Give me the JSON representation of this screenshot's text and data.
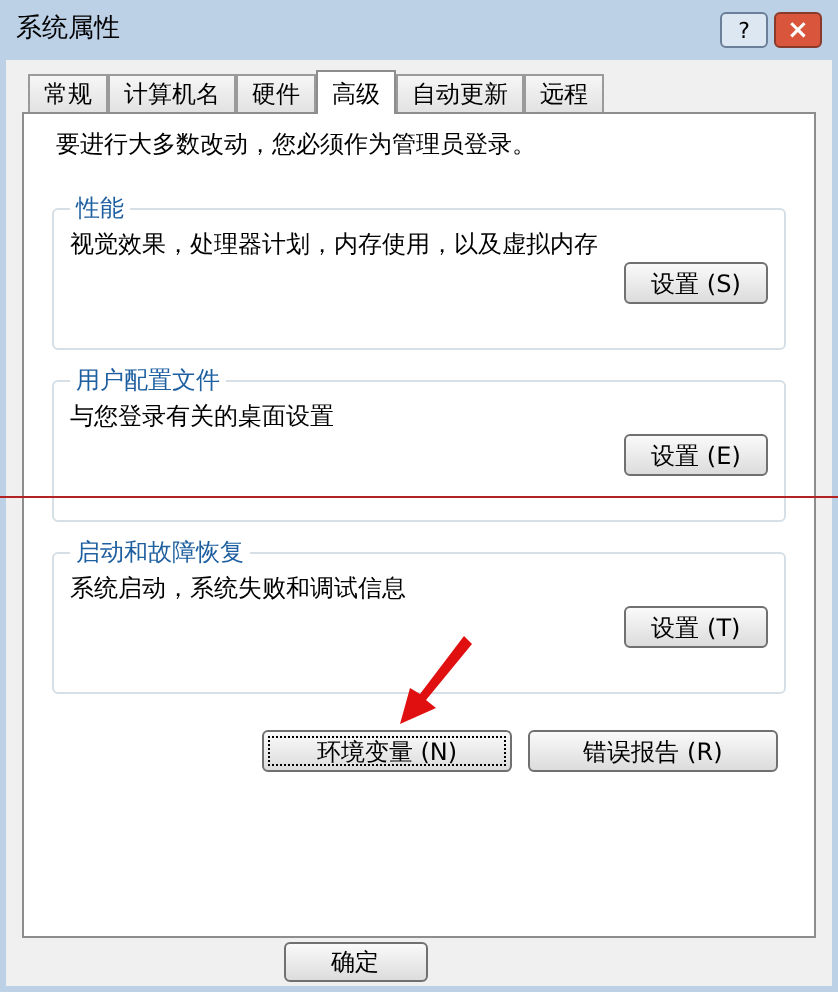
{
  "window": {
    "title": "系统属性",
    "controls": [
      "?",
      "×"
    ]
  },
  "tabs": [
    {
      "label": "常规",
      "selected": false
    },
    {
      "label": "计算机名",
      "selected": false
    },
    {
      "label": "硬件",
      "selected": false
    },
    {
      "label": "高级",
      "selected": true
    },
    {
      "label": "自动更新",
      "selected": false
    },
    {
      "label": "远程",
      "selected": false
    }
  ],
  "notice": "要进行大多数改动，您必须作为管理员登录。",
  "groups": [
    {
      "title": "性能",
      "description": "视觉效果，处理器计划，内存使用，以及虚拟内存",
      "button": "设置 (S)"
    },
    {
      "title": "用户配置文件",
      "description": "与您登录有关的桌面设置",
      "button": "设置 (E)"
    },
    {
      "title": "启动和故障恢复",
      "description": "系统启动，系统失败和调试信息",
      "button": "设置 (T)"
    }
  ],
  "buttons": [
    {
      "label": "环境变量 (N)",
      "focused": true
    },
    {
      "label": "错误报告 (R)",
      "focused": false
    }
  ],
  "footer_buttons": [
    "确定"
  ]
}
